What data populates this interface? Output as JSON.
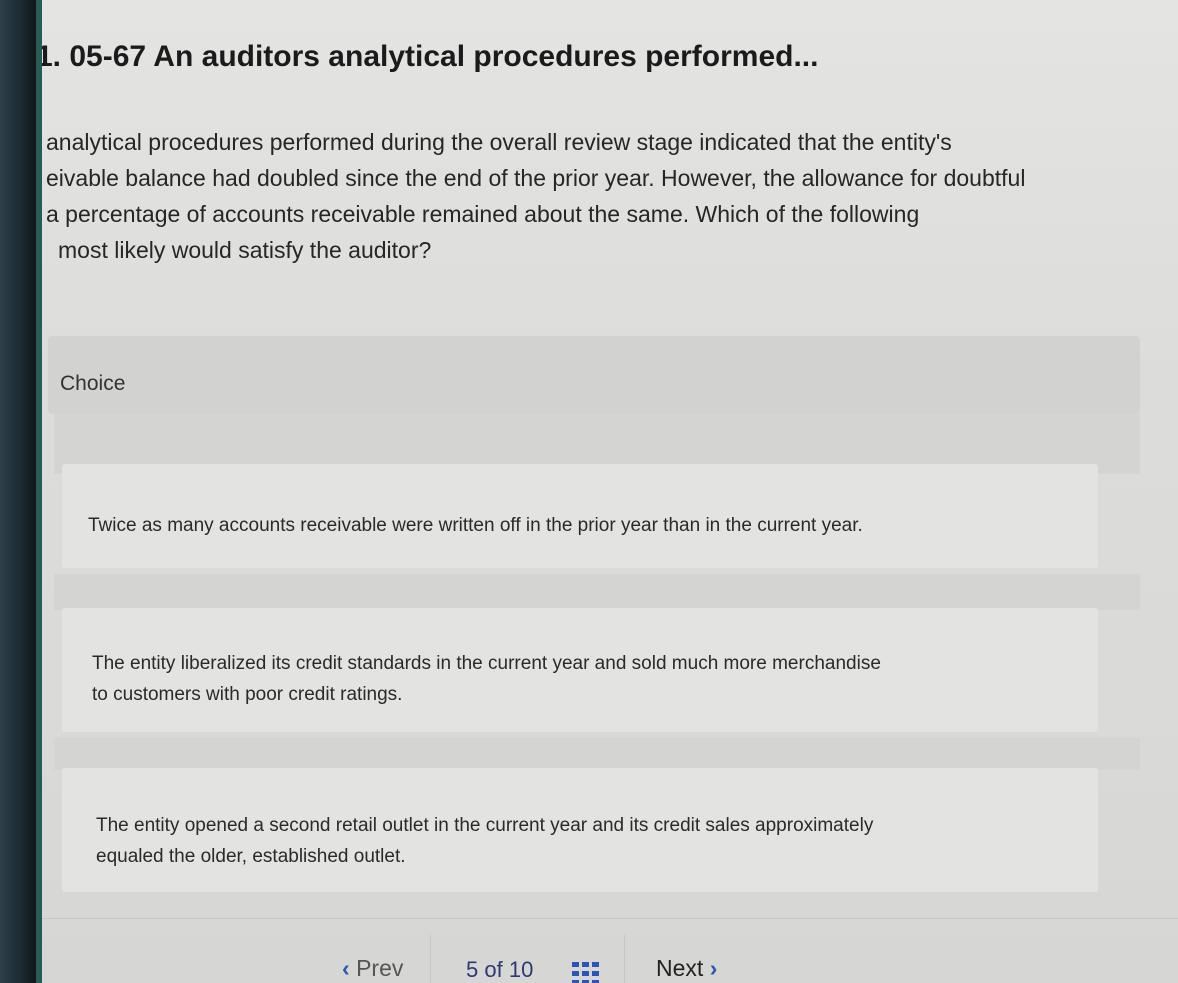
{
  "question": {
    "title": "1. 05-67 An auditors analytical procedures performed...",
    "body_lines": [
      "analytical procedures performed during the overall review stage indicated that the entity's",
      "eivable balance had doubled since the end of the prior year. However, the allowance for doubtful",
      "a percentage of accounts receivable remained about the same. Which of the following",
      "most likely would satisfy the auditor?"
    ]
  },
  "choices": {
    "header_label": "Choice",
    "options": [
      "Twice as many accounts receivable were written off in the prior year than in the current year.",
      "The entity liberalized its credit standards in the current year and sold much more merchandise to customers with poor credit ratings.",
      "The entity opened a second retail outlet in the current year and its credit sales approximately equaled the older, established outlet."
    ]
  },
  "footer": {
    "prev_label": "Prev",
    "page_current": "5",
    "page_of": "of",
    "page_total": "10",
    "next_label": "Next",
    "grid_icon": "grid-icon",
    "next_icon": "chevron-right-icon",
    "prev_icon": "chevron-left-icon"
  },
  "colors": {
    "page_count": "#2a3b72",
    "chevron": "#2c55b8"
  }
}
